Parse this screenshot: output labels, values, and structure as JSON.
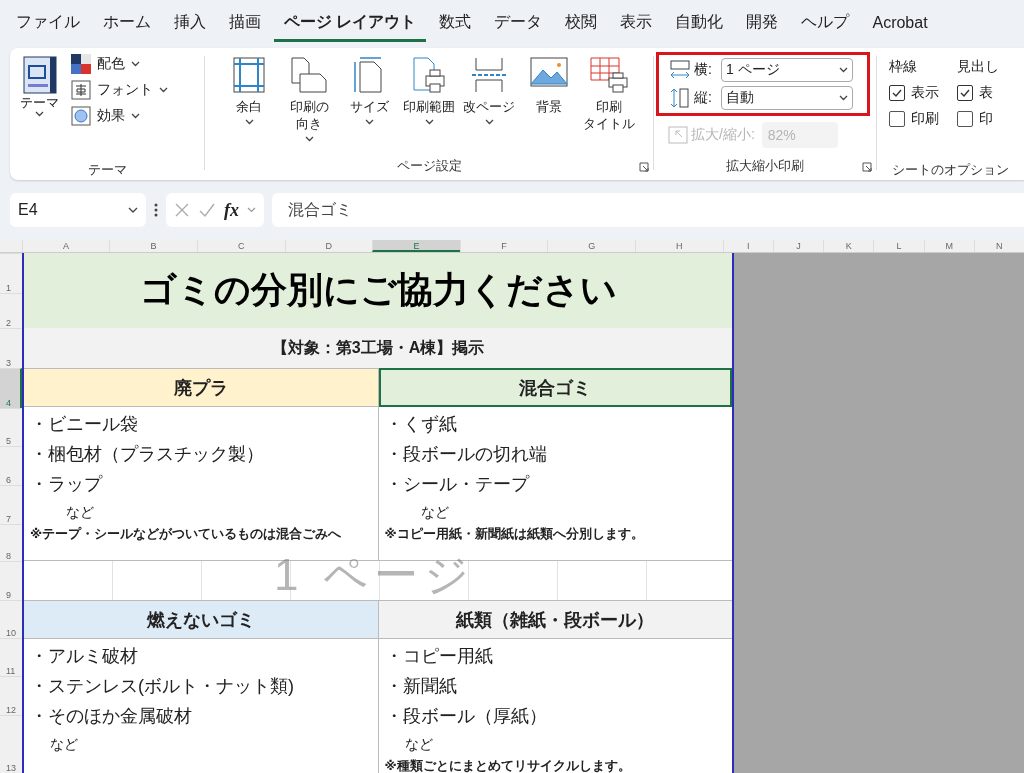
{
  "menu_tabs": [
    {
      "label": "ファイル",
      "selected": false
    },
    {
      "label": "ホーム",
      "selected": false
    },
    {
      "label": "挿入",
      "selected": false
    },
    {
      "label": "描画",
      "selected": false
    },
    {
      "label": "ページ レイアウト",
      "selected": true
    },
    {
      "label": "数式",
      "selected": false
    },
    {
      "label": "データ",
      "selected": false
    },
    {
      "label": "校閲",
      "selected": false
    },
    {
      "label": "表示",
      "selected": false
    },
    {
      "label": "自動化",
      "selected": false
    },
    {
      "label": "開発",
      "selected": false
    },
    {
      "label": "ヘルプ",
      "selected": false
    },
    {
      "label": "Acrobat",
      "selected": false
    }
  ],
  "theme_group": {
    "theme_button": "テーマ",
    "items": [
      {
        "kind": "colors",
        "label": "配色"
      },
      {
        "kind": "fonts",
        "label": "フォント"
      },
      {
        "kind": "effects",
        "label": "効果"
      }
    ],
    "label": "テーマ"
  },
  "page_setup_group": {
    "buttons": [
      {
        "kind": "margins",
        "label": "余白",
        "dropdown": true
      },
      {
        "kind": "orientation",
        "label": [
          "印刷の",
          "向き"
        ],
        "dropdown": true
      },
      {
        "kind": "size",
        "label": "サイズ",
        "dropdown": true
      },
      {
        "kind": "print_area",
        "label": "印刷範囲",
        "dropdown": true
      },
      {
        "kind": "breaks",
        "label": "改ページ",
        "dropdown": true
      },
      {
        "kind": "background",
        "label": "背景",
        "dropdown": false
      },
      {
        "kind": "print_titles",
        "label": [
          "印刷",
          "タイトル"
        ],
        "dropdown": false
      }
    ],
    "label": "ページ設定"
  },
  "scale_group": {
    "width": {
      "label": "横:",
      "value": "1 ページ"
    },
    "height": {
      "label": "縦:",
      "value": "自動"
    },
    "scale": {
      "label": "拡大/縮小:",
      "value": "82%",
      "disabled": true
    },
    "label": "拡大縮小印刷"
  },
  "sheet_options": {
    "label": "シートのオプション",
    "columns": [
      {
        "title": "枠線",
        "options": [
          {
            "label": "表示",
            "checked": true
          },
          {
            "label": "印刷",
            "checked": false
          }
        ]
      },
      {
        "title": "見出し",
        "options": [
          {
            "label": "表",
            "checked": true
          },
          {
            "label": "印",
            "checked": false
          }
        ]
      }
    ]
  },
  "formula_bar": {
    "name_box": "E4",
    "function_label": "fx",
    "formula": "混合ゴミ"
  },
  "columns": [
    {
      "label": "A",
      "selected": false
    },
    {
      "label": "B",
      "selected": false
    },
    {
      "label": "C",
      "selected": false
    },
    {
      "label": "D",
      "selected": false
    },
    {
      "label": "E",
      "selected": true
    },
    {
      "label": "F",
      "selected": false
    },
    {
      "label": "G",
      "selected": false
    },
    {
      "label": "H",
      "selected": false
    },
    {
      "label": "I",
      "selected": false
    },
    {
      "label": "J",
      "selected": false
    },
    {
      "label": "K",
      "selected": false
    },
    {
      "label": "L",
      "selected": false
    },
    {
      "label": "M",
      "selected": false
    },
    {
      "label": "N",
      "selected": false
    }
  ],
  "rows": [
    {
      "label": "1",
      "selected": false
    },
    {
      "label": "2",
      "selected": false
    },
    {
      "label": "3",
      "selected": false
    },
    {
      "label": "4",
      "selected": true
    },
    {
      "label": "5",
      "selected": false
    },
    {
      "label": "6",
      "selected": false
    },
    {
      "label": "7",
      "selected": false
    },
    {
      "label": "8",
      "selected": false
    },
    {
      "label": "9",
      "selected": false
    },
    {
      "label": "10",
      "selected": false
    },
    {
      "label": "11",
      "selected": false
    },
    {
      "label": "12",
      "selected": false
    },
    {
      "label": "13",
      "selected": false
    }
  ],
  "sheet": {
    "title": "ゴミの分別にご協力ください",
    "subtitle": "【対象：第3工場・A棟】掲示",
    "page_label": "1 ページ",
    "categories": [
      {
        "name": "廃プラ",
        "color": "#fff2cc",
        "selected": false,
        "items": [
          "・ビニール袋",
          "・梱包材（プラスチック製）",
          "・ラップ"
        ],
        "etc": "など",
        "note": "※テープ・シールなどがついているものは混合ごみへ"
      },
      {
        "name": "混合ゴミ",
        "color": "#e2efda",
        "selected": true,
        "items": [
          "・くず紙",
          "・段ボールの切れ端",
          "・シール・テープ"
        ],
        "etc": "など",
        "note": "※コピー用紙・新聞紙は紙類へ分別します。"
      },
      {
        "name": "燃えないゴミ",
        "color": "#ddebf7",
        "selected": false,
        "items": [
          "・アルミ破材",
          "・ステンレス(ボルト・ナット類)",
          "・そのほか金属破材"
        ],
        "etc": "など"
      },
      {
        "name": "紙類（雑紙・段ボール）",
        "color": "#f2f2f2",
        "selected": false,
        "items": [
          "・コピー用紙",
          "・新聞紙",
          "・段ボール（厚紙）"
        ],
        "etc": "など",
        "note": "※種類ごとにまとめてリサイクルします。"
      }
    ]
  }
}
